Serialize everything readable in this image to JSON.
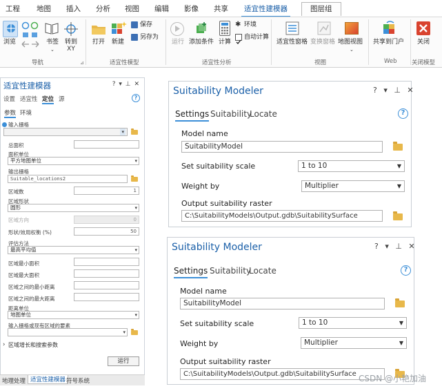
{
  "ribbon": {
    "tabs": [
      "工程",
      "地图",
      "插入",
      "分析",
      "视图",
      "编辑",
      "影像",
      "共享",
      "适宜性建模器",
      "图层组"
    ],
    "active_tab": "适宜性建模器",
    "buttons": {
      "browse": "浏览",
      "bookmarks": "书签",
      "goto_xy": "转到\nXY",
      "open": "打开",
      "new": "新建",
      "save": "保存",
      "save_as": "另存为",
      "run": "运行",
      "add_criteria": "添加条件",
      "calculate": "计算",
      "environments": "环境",
      "auto_calculate": "自动计算",
      "suitability_pane": "适宜性窗格",
      "transform_pane": "变换窗格",
      "map_view": "地图视图",
      "share_portal": "共享到门户",
      "close": "关闭"
    },
    "groups": {
      "navigate": "导航",
      "suitability_model": "适宜性模型",
      "suitability_analysis": "适宜性分析",
      "view": "视图",
      "web": "Web",
      "close_model": "关闭模型"
    }
  },
  "cn_pane": {
    "title": "适宜性建模器",
    "controls": "? ▾ ⊥ ✕",
    "tabs": [
      "设置",
      "适宜性",
      "定位",
      "源"
    ],
    "active_tab": "定位",
    "subtabs": [
      "参数",
      "环境"
    ],
    "active_subtab": "参数",
    "fields": {
      "input_raster_label": "输入栅格",
      "total_area_label": "总面积",
      "area_unit_label": "面积单位",
      "area_unit_value": "平方地图单位",
      "output_raster_label": "输出栅格",
      "output_raster_value": "Suitable_locations2",
      "num_regions_label": "区域数",
      "num_regions_value": "1",
      "region_shape_label": "区域形状",
      "region_shape_value": "圆形",
      "region_orientation_label": "区域方向",
      "region_orientation_value": "0",
      "shape_tradeoff_label": "形状/效用权衡 (%)",
      "shape_tradeoff_value": "50",
      "eval_method_label": "评估方法",
      "eval_method_value": "最高平均值",
      "min_area_label": "区域最小面积",
      "max_area_label": "区域最大面积",
      "min_dist_label": "区域之间的最小距离",
      "max_dist_label": "区域之间的最大距离",
      "dist_unit_label": "距离单位",
      "dist_unit_value": "地图单位",
      "existing_regions_label": "输入栅格或现有区域的要素",
      "growth_search_label": "区域增长和搜索参数"
    },
    "run_label": "运行",
    "bottom_tabs": [
      "地理处理",
      "适宜性建模器",
      "符号系统"
    ],
    "active_bottom_tab": "适宜性建模器"
  },
  "en_pane_top": {
    "title": "Suitability Modeler",
    "controls": "? ▾ ⊥ ✕",
    "tabs": [
      "Settings",
      "Suitability",
      "Locate"
    ],
    "active_tab": "Settings",
    "model_name_label": "Model name",
    "model_name_value": "SuitabilityModel",
    "scale_label": "Set suitability scale",
    "scale_value": "1 to 10",
    "weight_label": "Weight by",
    "weight_value": "Multiplier",
    "output_label": "Output suitability raster",
    "output_value": "C:\\SuitabilityModels\\Output.gdb\\SuitabilitySurface"
  },
  "en_pane_bottom": {
    "title": "Suitability Modeler",
    "controls": "? ▾ ⊥ ✕",
    "tabs": [
      "Settings",
      "Suitability",
      "Locate"
    ],
    "active_tab": "Settings",
    "model_name_label": "Model name",
    "model_name_value": "SuitabilityModel",
    "scale_label": "Set suitability scale",
    "scale_value": "1 to 10",
    "weight_label": "Weight by",
    "weight_value": "Multiplier",
    "output_label": "Output suitability raster",
    "output_value": "C:\\SuitabilityModels\\Output.gdb\\SuitabilitySurface"
  },
  "watermark": "CSDN @小艳加油",
  "colors": {
    "accent": "#3c8fd8",
    "title_blue": "#1a5fa8",
    "folder": "#e8b84a",
    "close_red": "#d9432f"
  }
}
